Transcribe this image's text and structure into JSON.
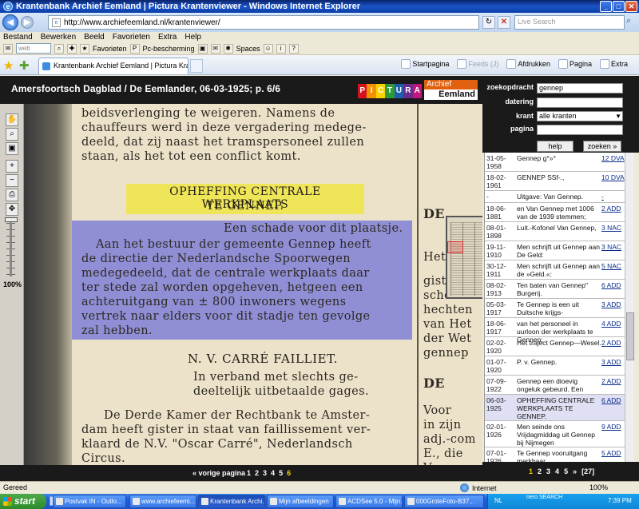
{
  "window": {
    "title": "Krantenbank Archief Eemland | Pictura Krantenviewer - Windows Internet Explorer",
    "url": "http://www.archiefeemland.nl/krantenviewer/",
    "search_placeholder": "Live Search"
  },
  "menu": [
    "Bestand",
    "Bewerken",
    "Beeld",
    "Favorieten",
    "Extra",
    "Help"
  ],
  "links_bar": {
    "websearch_placeholder": "web zoeken...",
    "favorieten": "Favorieten",
    "pc_bescherming": "Pc-bescherming",
    "spaces": "Spaces"
  },
  "tab": {
    "label": "Krantenbank Archief Eemland | Pictura Krantenviewer"
  },
  "commands": {
    "startpagina": "Startpagina",
    "feeds": "Feeds (J)",
    "afdrukken": "Afdrukken",
    "pagina": "Pagina",
    "extra": "Extra"
  },
  "viewer": {
    "doc_title": "Amersfoortsch Dagblad / De Eemlander, 06-03-1925; p. 6/6",
    "pictura_letters": [
      "P",
      "I",
      "C",
      "T",
      "U",
      "R",
      "A"
    ],
    "pictura_colors": [
      "#d3141e",
      "#f39200",
      "#f7d400",
      "#2e9a3a",
      "#1d5fae",
      "#6a2b8c",
      "#c2177a"
    ],
    "archief_line1": "Archief",
    "archief_line2": "Eemland",
    "zoom_label": "100%"
  },
  "article": {
    "top_lines": [
      "beidsverlenging  te  weigeren.  Namens  de",
      "chauffeurs werd in deze vergadering medege-",
      "deeld, dat zij naast het tramspersoneel zullen",
      "staan, als het tot een conflict komt."
    ],
    "headline_1": "OPHEFFING CENTRALE WERKPLAATS",
    "headline_2": "TE GENNEP.",
    "sub": "Een schade voor dit plaatsje.",
    "body_lines": [
      "Aan het bestuur der gemeente Gennep heeft",
      "de directie der Nederlandsche Spoorwegen",
      "medegedeeld, dat de centrale werkplaats daar",
      "ter stede zal worden opgeheven, hetgeen een",
      "achteruitgang  van  ± 800  inwoners wegens",
      "vertrek naar elders voor dit stadje ten gevolge",
      "zal hebben."
    ],
    "headline_3": "N. V. CARRÉ FAILLIET.",
    "sub2_lines": [
      "In verband met slechts ge-",
      "deeltelijk uitbetaalde gages."
    ],
    "carre_lines": [
      "De Derde Kamer der Rechtbank te Amster-",
      "dam heeft gister in staat van faillissement ver-",
      "klaard de N.V. \"Oscar Carré\", Nederlandsch",
      "Circus."
    ],
    "right_col": [
      {
        "t": "DE",
        "big": true
      },
      {
        "t": "Het g",
        "big": false
      },
      {
        "t": "gister v",
        "big": false
      },
      {
        "t": "schede",
        "big": false
      },
      {
        "t": "hechten",
        "big": false
      },
      {
        "t": "van Het",
        "big": false
      },
      {
        "t": "der Wet",
        "big": false
      },
      {
        "t": "gennep",
        "big": false
      },
      {
        "t": "DE",
        "big": true
      },
      {
        "t": "Voor",
        "big": false
      },
      {
        "t": "in zijn",
        "big": false
      },
      {
        "t": "adj.-com",
        "big": false
      },
      {
        "t": "E., die",
        "big": false
      },
      {
        "t": "Veen er",
        "big": false
      }
    ]
  },
  "pagenav": {
    "prev": "« vorige pagina",
    "pages": [
      "1",
      "2",
      "3",
      "4",
      "5",
      "6"
    ],
    "active": "6"
  },
  "search": {
    "zoekopdracht_label": "zoekopdracht",
    "zoekopdracht_value": "gennep",
    "datering_label": "datering",
    "krant_label": "krant",
    "krant_value": "alle kranten",
    "pagina_label": "pagina",
    "help": "help",
    "zoeken": "zoeken »"
  },
  "results": [
    {
      "date": "31-05-1958",
      "snip": "Gennep g°»°",
      "link": "12 DVA"
    },
    {
      "date": "18-02-1961",
      "snip": "GENNEP SSf-.,",
      "link": "10 DVA"
    },
    {
      "date": "-",
      "snip": "Uitgave: Van Gennep.",
      "link": "-"
    },
    {
      "date": "18-06-1881",
      "snip": "en Van Gennep met 1006 van de 1939 stemmen;",
      "link": "2 ADD"
    },
    {
      "date": "08-01-1898",
      "snip": "Luit.-Kofonel Van Gennep,",
      "link": "3 NAC"
    },
    {
      "date": "19-11-1910",
      "snip": "Men schrijft uit Gennep aan De Geld:",
      "link": "3 NAC"
    },
    {
      "date": "30-12-1911",
      "snip": "Men schrijft uit Gennep aan de »Geld.«:",
      "link": "5 NAC"
    },
    {
      "date": "08-02-1913",
      "snip": "Ten baten van Gennep\" Burgerij.",
      "link": "6 ADD"
    },
    {
      "date": "05-03-1917",
      "snip": "Te Gennep is een uit Duitsche krijgs-",
      "link": "3 ADD"
    },
    {
      "date": "18-06-1917",
      "snip": "van het personeel in uurloon der werkplaats te Gennep;",
      "link": "4 ADD"
    },
    {
      "date": "02-02-1920",
      "snip": "Het traject Gennep—Wesel.",
      "link": "2 ADD"
    },
    {
      "date": "01-07-1920",
      "snip": "P. v. Gennep.",
      "link": "3 ADD"
    },
    {
      "date": "07-09-1922",
      "snip": "Gennep een dioevig ongeluk gebeurd. Een",
      "link": "2 ADD"
    },
    {
      "date": "06-03-1925",
      "snip": "OPHEFFING CENTRALE WERKPLAATS TE GENNEP.",
      "link": "6 ADD"
    },
    {
      "date": "02-01-1926",
      "snip": "Men seinde ons Vrijdagmiddag uit Gennep bij Nijmegen",
      "link": "9 ADD"
    },
    {
      "date": "07-01-1926",
      "snip": "Te Gennep vooruitgang merkbaar.",
      "link": "5 ADD"
    }
  ],
  "results_pages": {
    "pages": [
      "1",
      "2",
      "3",
      "4",
      "5"
    ],
    "active": "1",
    "next": "»",
    "total": "[27]"
  },
  "status": {
    "left": "Gereed",
    "zone": "Internet",
    "zoom": "100%"
  },
  "taskbar": {
    "start": "start",
    "items": [
      "Postvak IN - Outlo...",
      "www.archiefeemi...",
      "Krantenbank Archi...",
      "Mijn afbeeldingen",
      "ACDSee 5.0 - Mijn...",
      "000GroteFoto-B37..."
    ],
    "active_index": 2,
    "lang": "NL",
    "nero": "nero SEARCH",
    "clock": "7:39 PM"
  }
}
